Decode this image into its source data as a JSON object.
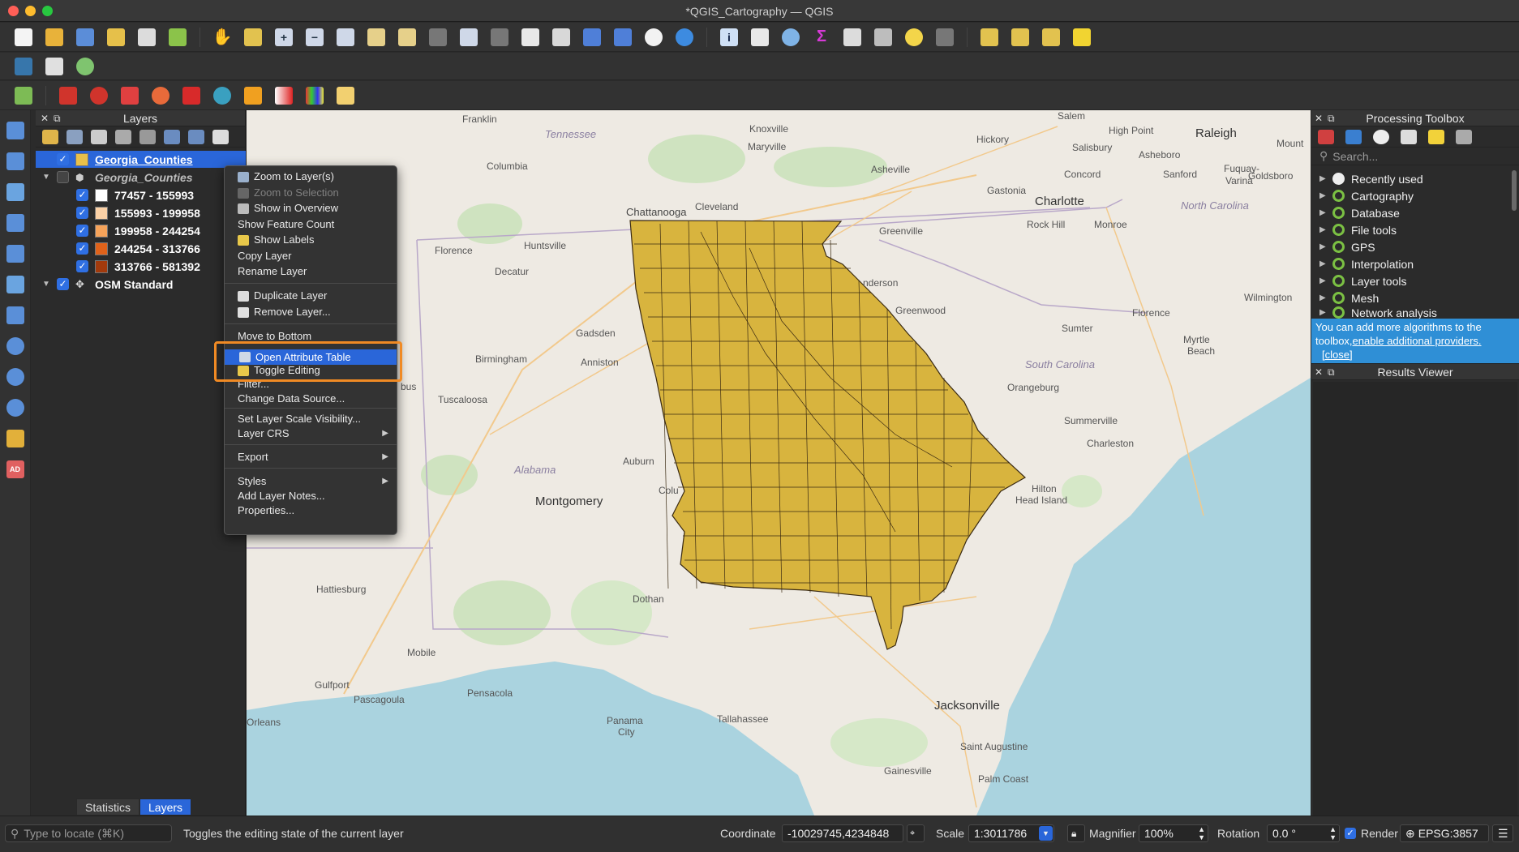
{
  "window": {
    "title": "*QGIS_Cartography — QGIS"
  },
  "layers_panel": {
    "title": "Layers",
    "items": [
      {
        "label": "Georgia_Counties",
        "selected": true
      },
      {
        "label": "Georgia_Counties",
        "italic": true
      },
      {
        "label": "77457 - 155993",
        "color": "#ffffff"
      },
      {
        "label": "155993 - 199958",
        "color": "#fbd1a6"
      },
      {
        "label": "199958 - 244254",
        "color": "#f6a35a"
      },
      {
        "label": "244254 - 313766",
        "color": "#e0621a"
      },
      {
        "label": "313766 - 581392",
        "color": "#a23a0c"
      },
      {
        "label": "OSM Standard"
      }
    ],
    "tabs": [
      "Statistics",
      "Layers"
    ]
  },
  "context_menu": {
    "items": [
      {
        "label": "Zoom to Layer(s)",
        "icon": "magnifier-icon"
      },
      {
        "label": "Zoom to Selection",
        "icon": "magnifier-icon",
        "disabled": true
      },
      {
        "label": "Show in Overview",
        "icon": "overview-icon"
      },
      {
        "label": "Show Feature Count"
      },
      {
        "label": "Show Labels",
        "icon": "label-icon"
      },
      {
        "label": "Copy Layer"
      },
      {
        "label": "Rename Layer"
      },
      {
        "label": "Duplicate Layer",
        "icon": "duplicate-icon"
      },
      {
        "label": "Remove Layer...",
        "icon": "remove-icon"
      },
      {
        "label": "Move to Bottom"
      },
      {
        "label": "Open Attribute Table",
        "icon": "table-icon",
        "highlighted": true
      },
      {
        "label": "Toggle Editing",
        "icon": "pencil-icon"
      },
      {
        "label": "Filter..."
      },
      {
        "label": "Change Data Source..."
      },
      {
        "label": "Set Layer Scale Visibility..."
      },
      {
        "label": "Layer CRS"
      },
      {
        "label": "Export"
      },
      {
        "label": "Styles"
      },
      {
        "label": "Add Layer Notes..."
      },
      {
        "label": "Properties..."
      }
    ]
  },
  "map": {
    "fill_color": "#d8b43e",
    "labels": {
      "franklin": "Franklin",
      "tennessee": "Tennessee",
      "knoxville": "Knoxville",
      "maryville": "Maryville",
      "asheville": "Asheville",
      "hickory": "Hickory",
      "salem": "Salem",
      "high_point": "High Point",
      "raleigh": "Raleigh",
      "salisbury": "Salisbury",
      "asheboro": "Asheboro",
      "mount": "Mount",
      "concord": "Concord",
      "sanford": "Sanford",
      "goldsboro": "Goldsboro",
      "fuquay": "Fuquay-",
      "varina": "Varina",
      "columbia_tn": "Columbia",
      "gastonia": "Gastonia",
      "charlotte": "Charlotte",
      "north_carolina": "North Carolina",
      "chattanooga": "Chattanooga",
      "cleveland": "Cleveland",
      "rock_hill": "Rock Hill",
      "monroe": "Monroe",
      "greenville": "Greenville",
      "huntsville": "Huntsville",
      "florence_al": "Florence",
      "decatur": "Decatur",
      "anderson": "nderson",
      "wilmington": "Wilmington",
      "greenwood": "Greenwood",
      "florence_sc": "Florence",
      "gadsden": "Gadsden",
      "sumter": "Sumter",
      "myrtle": "Myrtle",
      "beach": "Beach",
      "birmingham": "Birmingham",
      "anniston": "Anniston",
      "south_carolina": "South Carolina",
      "orangeburg": "Orangeburg",
      "tuscaloosa": "Tuscaloosa",
      "bus": "bus",
      "summerville": "Summerville",
      "charleston": "Charleston",
      "alabama": "Alabama",
      "auburn": "Auburn",
      "montgomery": "Montgomery",
      "colu": "Colu",
      "hilton": "Hilton",
      "head_island": "Head Island",
      "hattiesburg": "Hattiesburg",
      "dothan": "Dothan",
      "mobile": "Mobile",
      "gulfport": "Gulfport",
      "pascagoula": "Pascagoula",
      "pensacola": "Pensacola",
      "tallahassee": "Tallahassee",
      "panama": "Panama",
      "city": "City",
      "orleans": "Orleans",
      "jacksonville": "Jacksonville",
      "saint_augustine": "Saint Augustine",
      "gainesville": "Gainesville",
      "palm_coast": "Palm Coast"
    }
  },
  "processing_toolbox": {
    "title": "Processing Toolbox",
    "search_placeholder": "Search...",
    "items": [
      "Recently used",
      "Cartography",
      "Database",
      "File tools",
      "GPS",
      "Interpolation",
      "Layer tools",
      "Mesh",
      "Network analysis"
    ],
    "info_text": "You can add more algorithms to the toolbox,",
    "info_link1": "enable additional providers.",
    "info_link2": "[close]"
  },
  "results_viewer": {
    "title": "Results Viewer"
  },
  "status_bar": {
    "locate_placeholder": "Type to locate (⌘K)",
    "message": "Toggles the editing state of the current layer",
    "coordinate_label": "Coordinate",
    "coordinate_value": "-10029745,4234848",
    "scale_label": "Scale",
    "scale_value": "1:3011786",
    "magnifier_label": "Magnifier",
    "magnifier_value": "100%",
    "rotation_label": "Rotation",
    "rotation_value": "0.0 °",
    "render_label": "Render",
    "crs": "EPSG:3857"
  }
}
